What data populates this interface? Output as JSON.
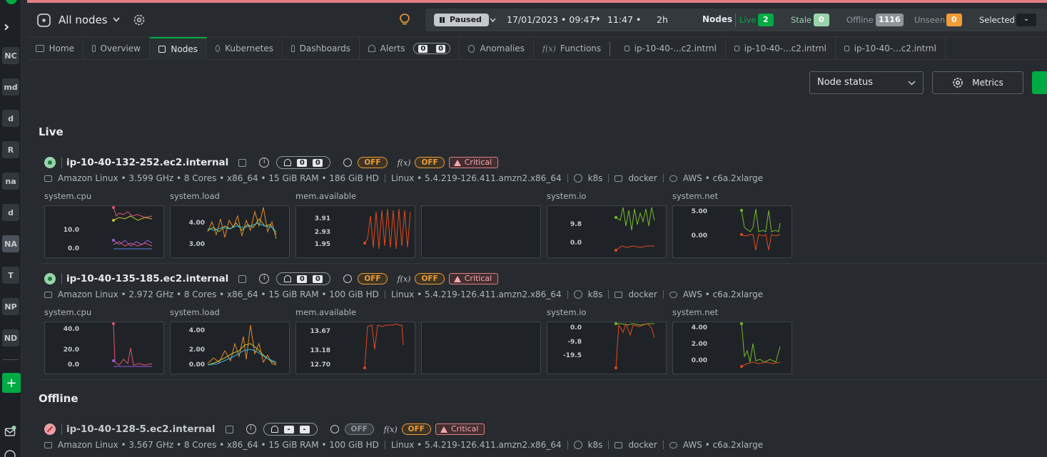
{
  "sidebar": {
    "spaces": [
      "NC",
      "md",
      "d",
      "R",
      "na",
      "d",
      "NA",
      "T",
      "NP",
      "ND"
    ],
    "active_index": 6
  },
  "header": {
    "room": "All nodes",
    "status": "Paused",
    "range_start": "17/01/2023 • 09:47",
    "range_arrow": "→",
    "range_end": "11:47 •",
    "duration": "2h",
    "nodes_label": "Nodes",
    "live_label": "Live",
    "live_count": "2",
    "stale_label": "Stale",
    "stale_count": "0",
    "offline_label": "Offline",
    "offline_count": "1116",
    "unseen_label": "Unseen",
    "unseen_count": "0",
    "selected_label": "Selected",
    "selected_value": "-"
  },
  "tabs": [
    {
      "label": "Home"
    },
    {
      "label": "Overview"
    },
    {
      "label": "Nodes"
    },
    {
      "label": "Kubernetes"
    },
    {
      "label": "Dashboards"
    },
    {
      "label": "Alerts",
      "critical": "0",
      "warning": "0"
    },
    {
      "label": "Anomalies"
    },
    {
      "label": "Functions"
    },
    {
      "label": "ip-10-40-...c2.intrnl"
    },
    {
      "label": "ip-10-40-...c2.intrnl"
    },
    {
      "label": "ip-10-40-...c2.intrnl"
    }
  ],
  "toolbar": {
    "group_select": "Node status",
    "metrics_button": "Metrics"
  },
  "sections": {
    "live": "Live",
    "offline": "Offline"
  },
  "nodes": [
    {
      "name": "ip-10-40-132-252.ec2.internal",
      "alerts_critical": "0",
      "alerts_warning": "0",
      "anomaly": "OFF",
      "functions": "OFF",
      "status": "Critical",
      "os": "Amazon Linux • 3.599 GHz • 8 Cores • x86_64 • 15 GiB RAM • 186 GiB HD",
      "kernel": "Linux • 5.4.219-126.411.amzn2.x86_64",
      "k8s": "k8s",
      "container": "docker",
      "cloud": "AWS • c6a.2xlarge",
      "charts": [
        {
          "label": "system.cpu",
          "ticks": [
            "10.0",
            "0.0"
          ]
        },
        {
          "label": "system.load",
          "ticks": [
            "4.00",
            "3.00"
          ]
        },
        {
          "label": "mem.available",
          "ticks": [
            "3.91",
            "2.93",
            "1.95"
          ]
        },
        {
          "label": "",
          "ticks": []
        },
        {
          "label": "system.io",
          "ticks": [
            "9.8",
            "0.0"
          ]
        },
        {
          "label": "system.net",
          "ticks": [
            "5.00",
            "0.00"
          ]
        }
      ]
    },
    {
      "name": "ip-10-40-135-185.ec2.internal",
      "alerts_critical": "0",
      "alerts_warning": "0",
      "anomaly": "OFF",
      "functions": "OFF",
      "status": "Critical",
      "os": "Amazon Linux • 2.972 GHz • 8 Cores • x86_64 • 15 GiB RAM • 100 GiB HD",
      "kernel": "Linux • 5.4.219-126.411.amzn2.x86_64",
      "k8s": "k8s",
      "container": "docker",
      "cloud": "AWS • c6a.2xlarge",
      "charts": [
        {
          "label": "system.cpu",
          "ticks": [
            "40.0",
            "20.0",
            "0.0"
          ]
        },
        {
          "label": "system.load",
          "ticks": [
            "4.00",
            "2.00",
            "0.00"
          ]
        },
        {
          "label": "mem.available",
          "ticks": [
            "13.67",
            "13.18",
            "12.70"
          ]
        },
        {
          "label": "",
          "ticks": []
        },
        {
          "label": "system.io",
          "ticks": [
            "0.0",
            "-9.8",
            "-19.5"
          ]
        },
        {
          "label": "system.net",
          "ticks": [
            "4.00",
            "2.00",
            "0.00"
          ]
        }
      ]
    },
    {
      "name": "ip-10-40-128-5.ec2.internal",
      "alerts_critical": "-",
      "alerts_warning": "-",
      "anomaly": "OFF",
      "functions": "OFF",
      "status": "Critical",
      "os": "Amazon Linux • 3.567 GHz • 8 Cores • x86_64 • 15 GiB RAM • 100 GiB HD",
      "kernel": "Linux • 5.4.219-126.411.amzn2.x86_64",
      "k8s": "k8s",
      "container": "docker",
      "cloud": "AWS • c6a.2xlarge"
    }
  ],
  "colors": {
    "live": "#00ab44",
    "stale": "#9ad3aa",
    "unseen": "#f29c36",
    "critical": "#e07e83",
    "cpu_series": [
      "#e0546e",
      "#c7c22b",
      "#9a59e0",
      "#4d7fe0"
    ],
    "load_series": [
      "#e6892b",
      "#c7c22b",
      "#33b5e5"
    ],
    "io_series": [
      "#77b82e",
      "#e2491c"
    ]
  }
}
